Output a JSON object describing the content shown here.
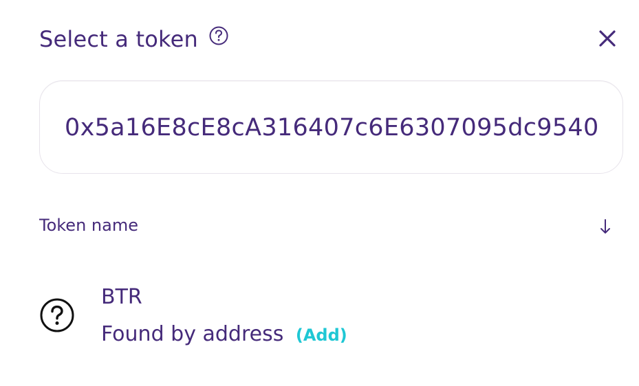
{
  "header": {
    "title": "Select a token",
    "help_icon": "question-circle-icon",
    "close_icon": "close-icon"
  },
  "search": {
    "value": "0x5a16E8cE8cA316407c6E6307095dc9540"
  },
  "list_header": {
    "sort_label": "Token name",
    "sort_icon": "arrow-down-icon"
  },
  "token": {
    "symbol": "BTR",
    "subtitle": "Found by address",
    "add_label": "(Add)",
    "icon": "question-circle-icon"
  },
  "colors": {
    "text_primary": "#452a7a",
    "accent": "#1fc7d4",
    "border": "#e7e3eb",
    "background": "#ffffff"
  }
}
